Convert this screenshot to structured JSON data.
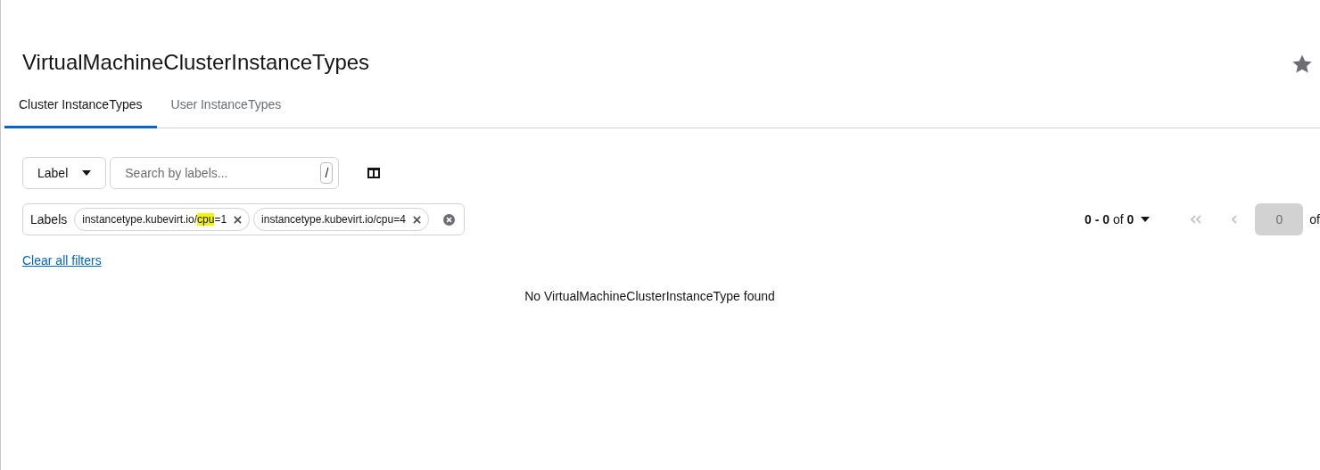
{
  "page": {
    "title": "VirtualMachineClusterInstanceTypes",
    "favorite": false
  },
  "tabs": [
    {
      "label": "Cluster InstanceTypes",
      "selected": true
    },
    {
      "label": "User InstanceTypes",
      "selected": false
    }
  ],
  "toolbar": {
    "filter_dropdown": "Label",
    "search": {
      "placeholder": "Search by labels...",
      "shortcut": "/"
    }
  },
  "filters": {
    "category": "Labels",
    "chips": [
      "instancetype.kubevirt.io/**cpu**=1",
      "instancetype.kubevirt.io/cpu=4"
    ],
    "clear_all": "Clear all filters"
  },
  "pagination": {
    "range": "**0 - 0** of **0**",
    "page": "0",
    "of": "of",
    "first_disabled": true,
    "prev_disabled": true
  },
  "empty_message": "No VirtualMachineClusterInstanceType found"
}
